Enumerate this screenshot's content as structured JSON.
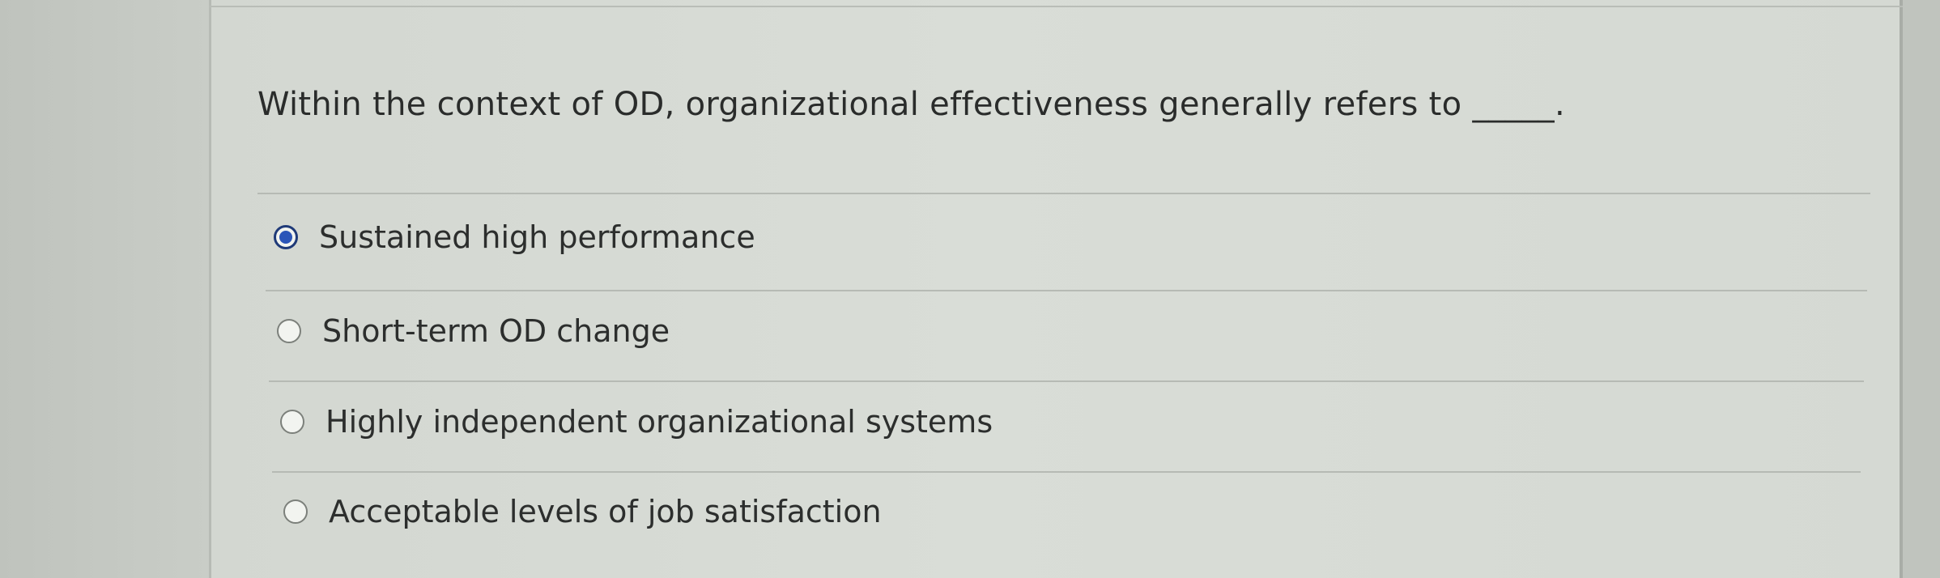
{
  "question": {
    "text": "Within the context of OD, organizational effectiveness generally refers to _____."
  },
  "options": [
    {
      "label": "Sustained high performance",
      "selected": true
    },
    {
      "label": "Short-term OD change",
      "selected": false
    },
    {
      "label": "Highly independent organizational systems",
      "selected": false
    },
    {
      "label": "Acceptable levels of job satisfaction",
      "selected": false
    }
  ],
  "colors": {
    "panel_background": "#d8dcd6",
    "radio_selected": "#2b55b8",
    "text": "#2c2e2d"
  }
}
